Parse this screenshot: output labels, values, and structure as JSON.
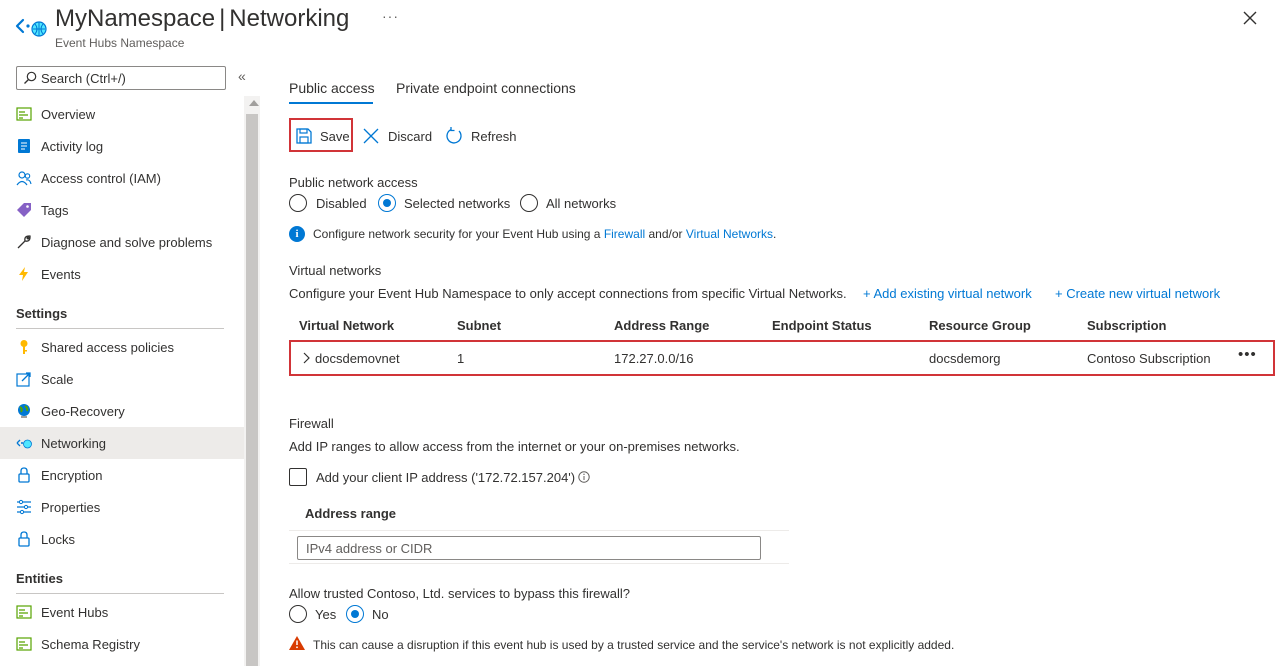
{
  "header": {
    "title": "MyNamespace",
    "title_separator": "|",
    "page": "Networking",
    "subtitle": "Event Hubs Namespace",
    "more": "···"
  },
  "sidebar": {
    "search_placeholder": "Search (Ctrl+/)",
    "collapse": "«",
    "items_top": [
      {
        "label": "Overview",
        "icon": "overview-icon"
      },
      {
        "label": "Activity log",
        "icon": "activity-log-icon"
      },
      {
        "label": "Access control (IAM)",
        "icon": "people-icon"
      },
      {
        "label": "Tags",
        "icon": "tag-icon"
      },
      {
        "label": "Diagnose and solve problems",
        "icon": "wrench-icon"
      },
      {
        "label": "Events",
        "icon": "lightning-icon"
      }
    ],
    "settings_label": "Settings",
    "items_settings": [
      {
        "label": "Shared access policies",
        "icon": "key-icon"
      },
      {
        "label": "Scale",
        "icon": "scale-icon"
      },
      {
        "label": "Geo-Recovery",
        "icon": "globe-icon"
      },
      {
        "label": "Networking",
        "icon": "networking-icon"
      },
      {
        "label": "Encryption",
        "icon": "lock-icon"
      },
      {
        "label": "Properties",
        "icon": "properties-icon"
      },
      {
        "label": "Locks",
        "icon": "lock-icon"
      }
    ],
    "entities_label": "Entities",
    "items_entities": [
      {
        "label": "Event Hubs",
        "icon": "event-hubs-icon"
      },
      {
        "label": "Schema Registry",
        "icon": "schema-registry-icon"
      }
    ]
  },
  "tabs": {
    "public_access": "Public access",
    "private_endpoint": "Private endpoint connections"
  },
  "toolbar": {
    "save": "Save",
    "discard": "Discard",
    "refresh": "Refresh"
  },
  "public_network": {
    "label": "Public network access",
    "options": [
      "Disabled",
      "Selected networks",
      "All networks"
    ],
    "selected": "Selected networks",
    "info_prefix": "Configure network security for your Event Hub using a ",
    "info_link1": "Firewall",
    "info_mid": " and/or ",
    "info_link2": "Virtual Networks",
    "info_suffix": "."
  },
  "virtual_networks": {
    "title": "Virtual networks",
    "description": "Configure your Event Hub Namespace to only accept connections from specific Virtual Networks.",
    "add_existing": "+ Add existing virtual network",
    "create_new": "+ Create new virtual network",
    "columns": [
      "Virtual Network",
      "Subnet",
      "Address Range",
      "Endpoint Status",
      "Resource Group",
      "Subscription"
    ],
    "rows": [
      {
        "virtual_network": "docsdemovnet",
        "subnet": "1",
        "address_range": "172.27.0.0/16",
        "endpoint_status": "",
        "resource_group": "docsdemorg",
        "subscription": "Contoso Subscription",
        "more": "•••"
      }
    ]
  },
  "firewall": {
    "title": "Firewall",
    "description": "Add IP ranges to allow access from the internet or your on-premises networks.",
    "client_ip_label": "Add your client IP address ('172.72.157.204')",
    "client_ip_checked": false,
    "address_range_header": "Address range",
    "address_placeholder": "IPv4 address or CIDR"
  },
  "trusted": {
    "question": "Allow trusted Contoso, Ltd. services to bypass this firewall?",
    "options": [
      "Yes",
      "No"
    ],
    "selected": "No",
    "warning": "This can cause a disruption if this event hub is used by a trusted service and the service's network is not explicitly added."
  },
  "colors": {
    "accent": "#0078d4",
    "highlight_border": "#d13438",
    "warning": "#d83b01"
  }
}
